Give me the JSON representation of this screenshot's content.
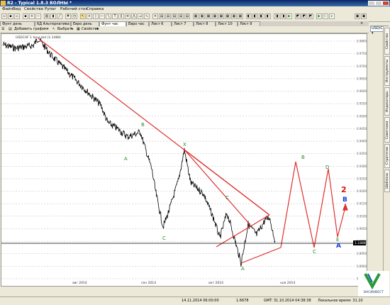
{
  "window": {
    "title": "R2 - Typical 1.8.3 ВОЛНЫ *"
  },
  "menu": [
    "Файл",
    "Вид",
    "Свойства",
    "Рупаг",
    "Рабочий стол",
    "Справка"
  ],
  "toolbar": {
    "currency_select": "USD/CHF"
  },
  "tabs": [
    "Фунт день",
    "6Д Альтернатива",
    "Евро день",
    "Фунт час",
    "Евро час",
    "Лист 6",
    "Лист 7",
    "Лист 8",
    "Лист 10",
    "Лист 9"
  ],
  "subtoolbar": {
    "add_chart": "Добавить график",
    "select": "Выбрать",
    "properties": "Свойства"
  },
  "chart": {
    "symbol_label": "USDCHF 1 hour bid (1.1488)",
    "price_label": "1.1888",
    "x_ticks": [
      "авг 2014",
      "сен 2014",
      "окт 2014",
      "ноя 2014"
    ],
    "y_ticks": [
      "0.9800",
      "0.9750",
      "0.9700",
      "0.9650",
      "0.9600",
      "0.9550",
      "0.9500",
      "0.9450",
      "0.9400",
      "0.9350",
      "0.9300",
      "0.9250",
      "0.9200",
      "0.9150",
      "0.9100",
      "0.9050",
      "0.9000",
      "0.8950",
      "0.8900",
      "0.8850"
    ],
    "wave_labels": [
      {
        "text": "A",
        "color": "#2a8a2a"
      },
      {
        "text": "B",
        "color": "#2a8a2a"
      },
      {
        "text": "C",
        "color": "#2a8a2a"
      },
      {
        "text": "X",
        "color": "#2a8a2a"
      },
      {
        "text": "A",
        "color": "#2a8a2a"
      },
      {
        "text": "C",
        "color": "#2a8a2a"
      },
      {
        "text": "B",
        "color": "#2a8a2a"
      },
      {
        "text": "C",
        "color": "#2a8a2a"
      },
      {
        "text": "D",
        "color": "#2a8a2a"
      },
      {
        "text": "E",
        "color": "#2a8a2a"
      }
    ],
    "projection_labels": {
      "two": "2",
      "b": "B",
      "a": "A"
    },
    "colors": {
      "trend": "#e03030",
      "wave_label": "#2a8a2a",
      "blue_label": "#1a3ad8",
      "red_label": "#e01010"
    }
  },
  "right_panel": [
    "Свойства",
    "Инструменты",
    "Индикаторы",
    "Советники",
    "Стратегии",
    "Шаблоны"
  ],
  "status": {
    "datetime1": "14.11.2014 06:00:00",
    "value": "1.6678",
    "gmt": "GMT: 31.10.2014 04:38:38",
    "local": "Локальное время: 31.10"
  },
  "logo": {
    "text": "ВАСИНВЕСТ"
  }
}
